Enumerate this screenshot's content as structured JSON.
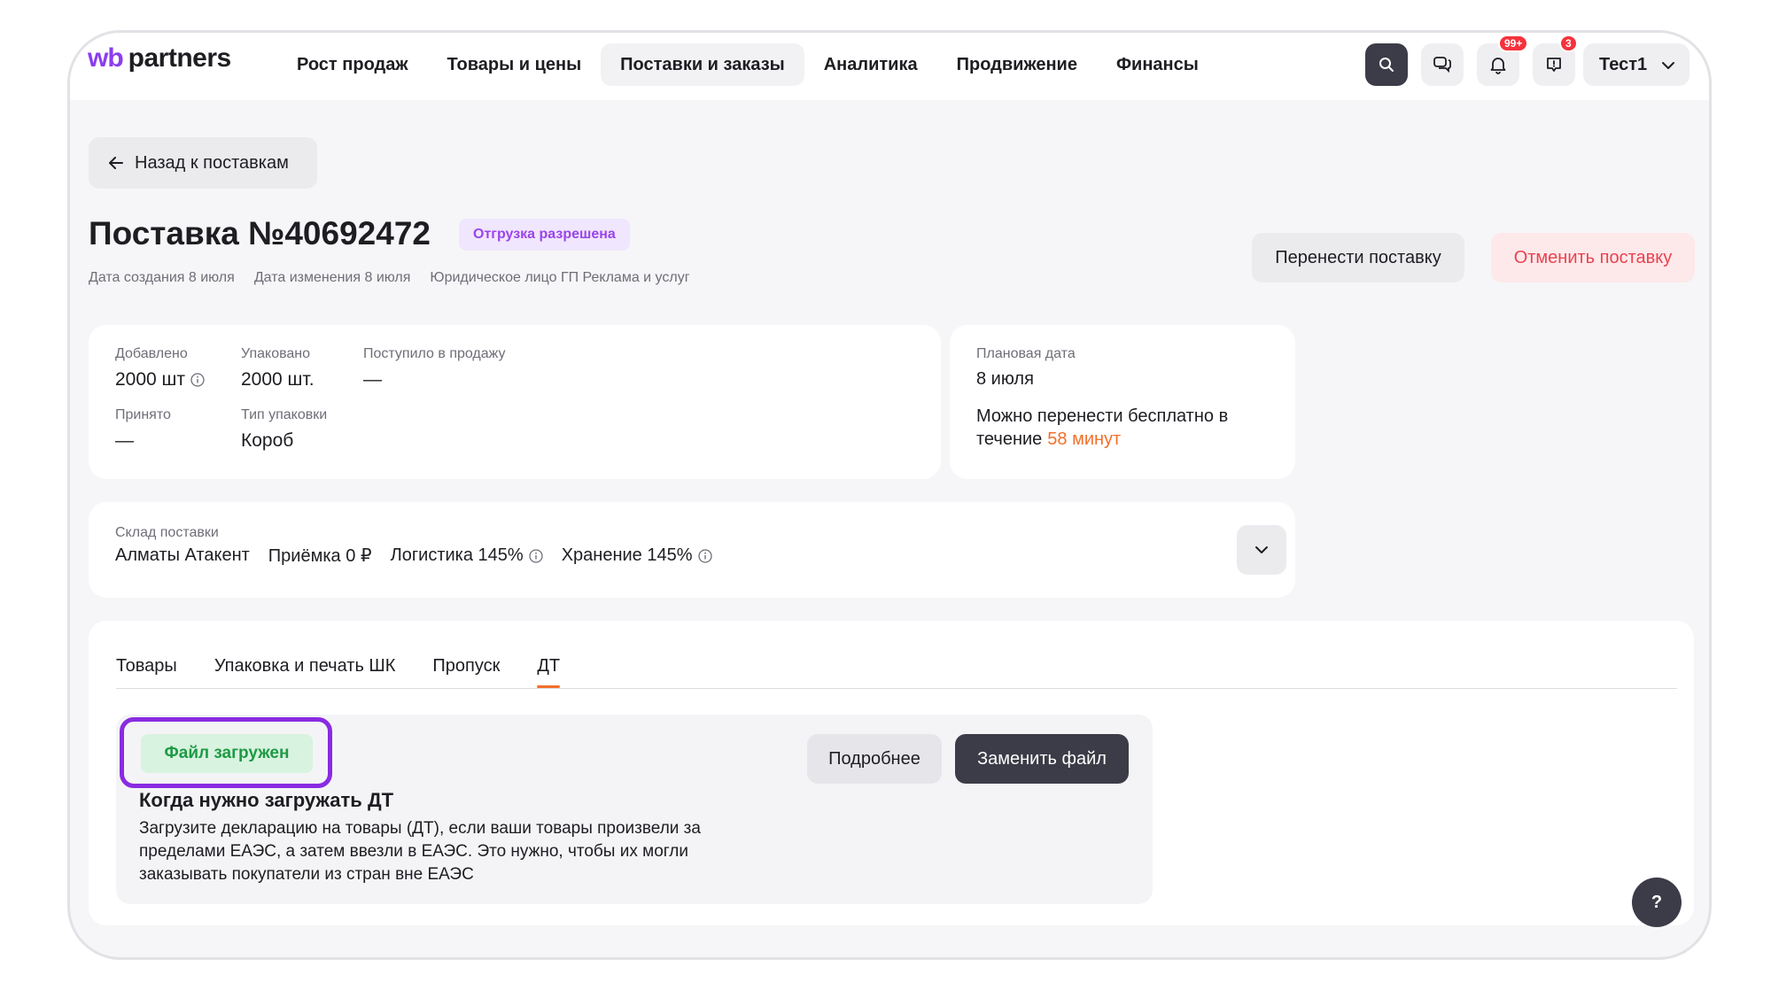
{
  "brand": {
    "wb": "wb",
    "partners": "partners"
  },
  "nav": [
    {
      "label": "Рост продаж"
    },
    {
      "label": "Товары и цены"
    },
    {
      "label": "Поставки и заказы",
      "active": true
    },
    {
      "label": "Аналитика"
    },
    {
      "label": "Продвижение"
    },
    {
      "label": "Финансы"
    }
  ],
  "header": {
    "notifications_badge": "99+",
    "feedback_badge": "3",
    "user_name": "Тест1"
  },
  "back_label": "Назад к поставкам",
  "supply": {
    "title": "Поставка №40692472",
    "status": "Отгрузка разрешена",
    "created": "Дата создания 8 июля",
    "modified": "Дата изменения 8 июля",
    "legal": "Юридическое лицо ГП Реклама и услуг"
  },
  "actions": {
    "move": "Перенести поставку",
    "cancel": "Отменить поставку"
  },
  "stats": {
    "added_label": "Добавлено",
    "added_value": "2000 шт",
    "packed_label": "Упаковано",
    "packed_value": "2000 шт.",
    "on_sale_label": "Поступило в продажу",
    "on_sale_value": "—",
    "accepted_label": "Принято",
    "accepted_value": "—",
    "pack_type_label": "Тип упаковки",
    "pack_type_value": "Короб"
  },
  "plan": {
    "label": "Плановая дата",
    "date": "8 июля",
    "move_text_1": "Можно перенести бесплатно в",
    "move_text_2": "течение",
    "move_time": "58 минут"
  },
  "warehouse": {
    "label": "Склад поставки",
    "name": "Алматы Атакент",
    "acceptance": "Приёмка 0 ₽",
    "logistics": "Логистика 145%",
    "storage": "Хранение 145%"
  },
  "tabs": [
    {
      "label": "Товары"
    },
    {
      "label": "Упаковка и печать ШК"
    },
    {
      "label": "Пропуск"
    },
    {
      "label": "ДТ",
      "active": true
    }
  ],
  "dt": {
    "status": "Файл загружен",
    "heading": "Когда нужно загружать ДТ",
    "text": "Загрузите декларацию на товары (ДТ), если ваши товары произвели за пределами ЕАЭС, а затем ввезли в ЕАЭС. Это нужно, чтобы их могли заказывать покупатели из стран вне ЕАЭС",
    "more_label": "Подробнее",
    "replace_label": "Заменить файл"
  },
  "help_label": "?",
  "colors": {
    "accent": "#8b3df0",
    "highlight": "#8a2be2",
    "orange": "#f36f2a",
    "danger": "#e9434f",
    "success": "#1f9a45"
  },
  "icons": [
    "search-icon",
    "chat-icon",
    "bell-icon",
    "feedback-icon",
    "chevron-down-icon",
    "arrow-left-icon",
    "info-icon"
  ]
}
